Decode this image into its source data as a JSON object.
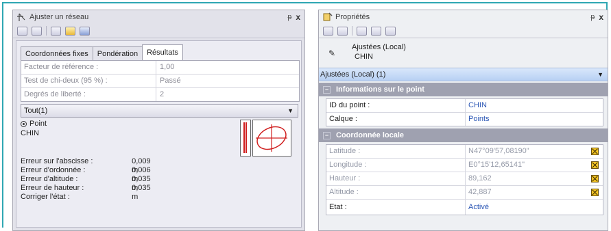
{
  "left_panel": {
    "title": "Ajuster un réseau",
    "pin": "ᵽ",
    "close": "x",
    "tabs": [
      "Coordonnées fixes",
      "Pondération",
      "Résultats"
    ],
    "results": [
      {
        "label": "Facteur de référence :",
        "value": "1,00"
      },
      {
        "label": "Test de chi-deux (95 %) :",
        "value": "Passé"
      },
      {
        "label": "Degrés de liberté :",
        "value": "2"
      }
    ],
    "filter": "Tout(1)",
    "point_option": "Point",
    "point_name": "CHIN",
    "errors": [
      {
        "label": "Erreur sur l'abscisse :",
        "value": "0,009 m"
      },
      {
        "label": "Erreur d'ordonnée :",
        "value": "0,006 m"
      },
      {
        "label": "Erreur d'altitude :",
        "value": "0,035 m"
      },
      {
        "label": "Erreur de hauteur :",
        "value": "0,035 m"
      },
      {
        "label": "Corriger l'état :",
        "value": ""
      }
    ]
  },
  "right_panel": {
    "title": "Propriétés",
    "pin": "ᵽ",
    "close": "x",
    "selection_line1": "Ajustées (Local)",
    "selection_line2": "CHIN",
    "combo": "Ajustées (Local) (1)",
    "section1": "Informations sur le point",
    "info_rows": [
      {
        "label": "ID du point :",
        "value": "CHIN"
      },
      {
        "label": "Calque :",
        "value": "Points"
      }
    ],
    "section2": "Coordonnée locale",
    "coord_rows": [
      {
        "label": "Latitude :",
        "value": "N47°09'57,08190\""
      },
      {
        "label": "Longitude :",
        "value": "E0°15'12,65141\""
      },
      {
        "label": "Hauteur :",
        "value": "89,162"
      },
      {
        "label": "Altitude :",
        "value": "42,887"
      }
    ],
    "state_label": "Etat :",
    "state_value": "Activé"
  },
  "colors": {
    "frame": "#2fa7b3",
    "error_red": "#d02020",
    "link_blue": "#2c57b5",
    "lock_yellow": "#f3c423",
    "section_grey": "#9fa1b0"
  }
}
